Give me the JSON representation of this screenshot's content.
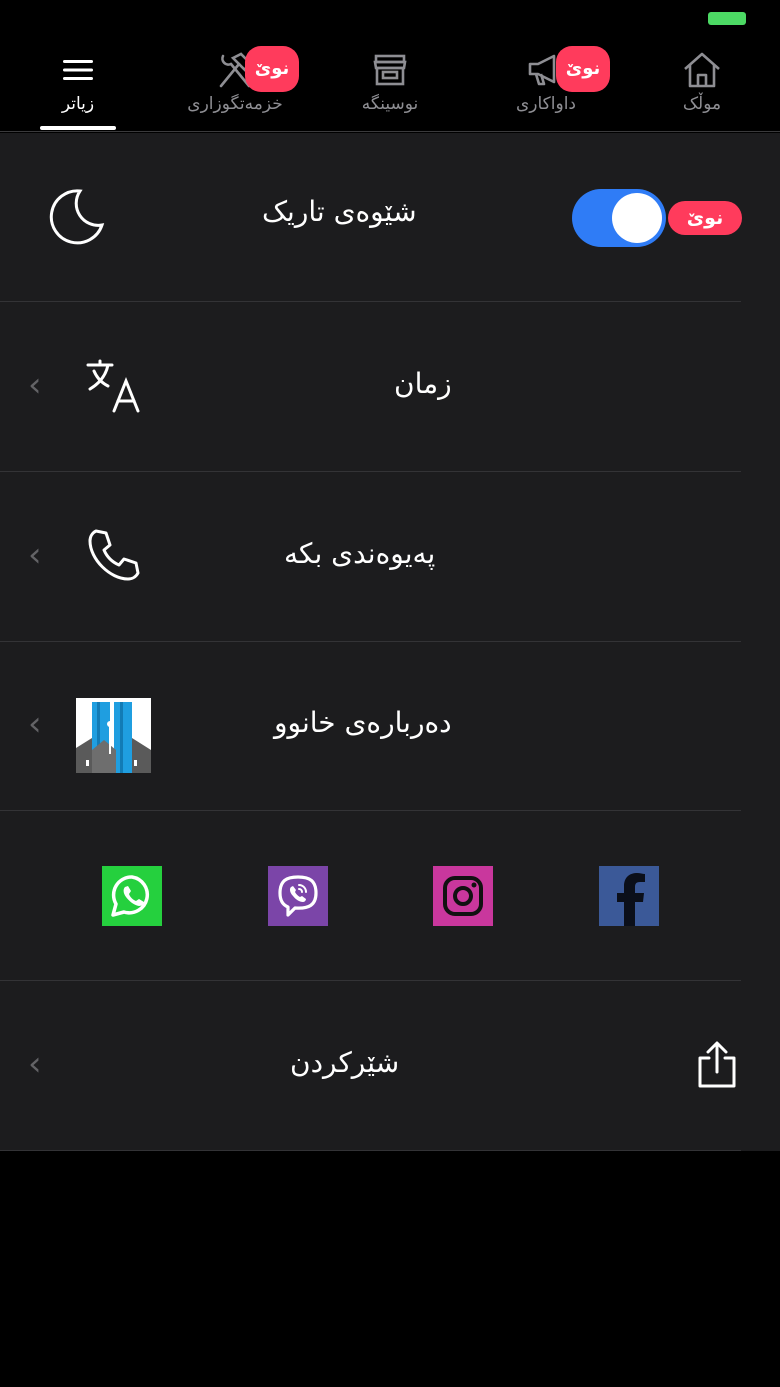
{
  "tabs": [
    {
      "id": "more",
      "label": "زیاتر",
      "icon": "menu-icon",
      "active": true
    },
    {
      "id": "services",
      "label": "خزمەتگوزاری",
      "icon": "tools-icon",
      "badge": "نوێ"
    },
    {
      "id": "office",
      "label": "نوسینگە",
      "icon": "store-icon"
    },
    {
      "id": "requests",
      "label": "داواکاری",
      "icon": "megaphone-icon",
      "badge": "نوێ"
    },
    {
      "id": "property",
      "label": "موڵک",
      "icon": "home-icon"
    }
  ],
  "settings": {
    "dark_mode": {
      "label": "شێوەی تاریک",
      "badge": "نوێ",
      "enabled": true
    },
    "language": {
      "label": "زمان"
    },
    "contact": {
      "label": "پەیوەندی بکە"
    },
    "about": {
      "label": "دەربارەی خانوو"
    },
    "share": {
      "label": "شێرکردن"
    }
  },
  "social": [
    {
      "name": "whatsapp",
      "color": "#25d03e"
    },
    {
      "name": "viber",
      "color": "#7b45a8"
    },
    {
      "name": "instagram",
      "color": "#c9379d"
    },
    {
      "name": "facebook",
      "color": "#3b5998"
    }
  ],
  "colors": {
    "accent": "#2f7cf6",
    "badge": "#ff3b5c",
    "panel": "#1c1c1e"
  }
}
